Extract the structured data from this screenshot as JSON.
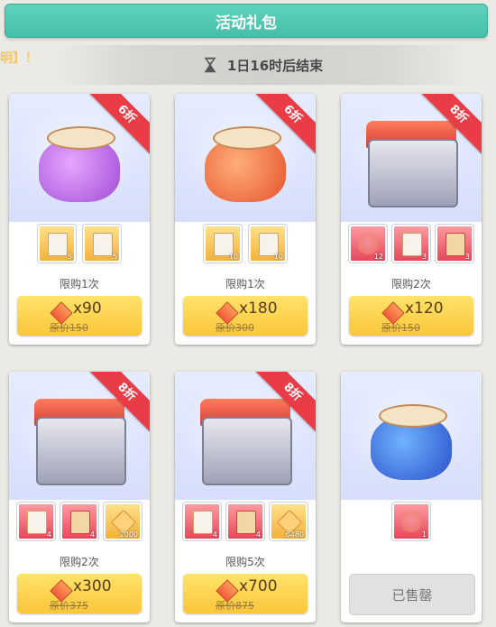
{
  "header": {
    "title": "活动礼包"
  },
  "notice": {
    "text": "明】！"
  },
  "timer": {
    "text": "1日16时后结束",
    "icon": "hourglass-icon"
  },
  "colors": {
    "header": "#4fc8b1",
    "ribbon": "#ea3c46",
    "button": "#fcd147"
  },
  "cards": [
    {
      "discount": "6折",
      "items": [
        {
          "qty": "5"
        },
        {
          "qty": "5"
        }
      ],
      "limit": "限购1次",
      "price": "x90",
      "original": "原价150"
    },
    {
      "discount": "6折",
      "items": [
        {
          "qty": "10"
        },
        {
          "qty": "10"
        }
      ],
      "limit": "限购1次",
      "price": "x180",
      "original": "原价300"
    },
    {
      "discount": "8折",
      "items": [
        {
          "qty": "12"
        },
        {
          "qty": "3"
        },
        {
          "qty": "3"
        }
      ],
      "limit": "限购2次",
      "price": "x120",
      "original": "原价150"
    },
    {
      "discount": "8折",
      "items": [
        {
          "qty": "4"
        },
        {
          "qty": "4"
        },
        {
          "qty": "2000"
        }
      ],
      "limit": "限购2次",
      "price": "x300",
      "original": "原价375"
    },
    {
      "discount": "8折",
      "items": [
        {
          "qty": "4"
        },
        {
          "qty": "4"
        },
        {
          "qty": "6480"
        }
      ],
      "limit": "限购5次",
      "price": "x700",
      "original": "原价875"
    },
    {
      "items": [
        {
          "qty": "1"
        }
      ],
      "soldout": "已售罄"
    }
  ]
}
